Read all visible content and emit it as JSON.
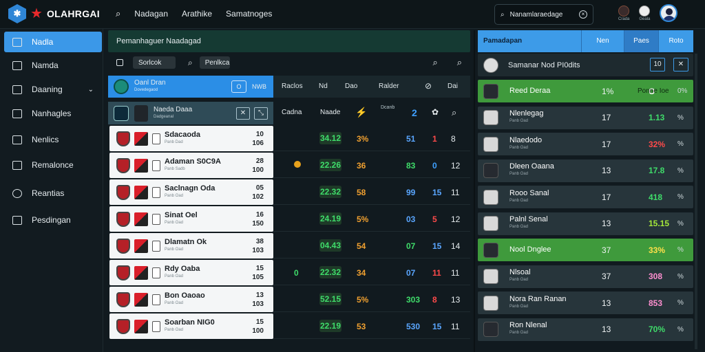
{
  "app": {
    "name": "OLAHRGAI",
    "star_icon": "star-icon",
    "logo_icon": "hex-logo-icon"
  },
  "topnav": [
    "Nadagan",
    "Arathike",
    "Samatnoges"
  ],
  "search": {
    "value": "Nanamlaraedage"
  },
  "top_icons": [
    {
      "label": "Crada"
    },
    {
      "label": "Geala"
    }
  ],
  "sidebar": {
    "items": [
      {
        "label": "Nadla",
        "active": true
      },
      {
        "label": "Namda"
      },
      {
        "label": "Daaning",
        "expandable": true
      },
      {
        "label": "Nanhagles"
      },
      {
        "label": "Nenlics"
      },
      {
        "label": "Remalonce"
      },
      {
        "label": "Reantias"
      },
      {
        "label": "Pesdingan"
      }
    ]
  },
  "main": {
    "title": "Pemanhaguer Naadagad",
    "filter": {
      "select": "Sorlcok",
      "tag": "Penlkca"
    },
    "header": {
      "team": "Oanl Dran",
      "sub": "Dovedegaod",
      "btn": "O",
      "btn2": "NWB",
      "cols": [
        "Raclos",
        "Nd",
        "Dao",
        "Ralder"
      ],
      "col_icons": [
        "⊘",
        "Dai"
      ]
    },
    "selected": {
      "name": "Naeda Daaa",
      "sub": "Dadgeanal",
      "col1": "Cadna",
      "col2": "Naade",
      "col3": "Dcanb"
    },
    "rows": [
      {
        "name": "Sdacaoda",
        "sub": "Panb Dad",
        "n1": "10",
        "n2": "106",
        "coin": false,
        "score": "34.12",
        "pct": "3%",
        "v1": "51",
        "v2": "1",
        "v3": "8",
        "v1c": "#5aa6ff",
        "v2c": "#ff4a4a"
      },
      {
        "name": "Adaman S0C9A",
        "sub": "Panb Sadb",
        "n1": "28",
        "n2": "100",
        "coin": true,
        "score": "22.26",
        "pct": "36",
        "v1": "83",
        "v2": "0",
        "v3": "12",
        "v1c": "#3fdc6a",
        "v2c": "#3fa0ff"
      },
      {
        "name": "Saclnagn Oda",
        "sub": "Panb Oad",
        "n1": "05",
        "n2": "102",
        "coin": false,
        "score": "22.32",
        "pct": "58",
        "v1": "99",
        "v2": "15",
        "v3": "11",
        "v1c": "#5aa6ff",
        "v2c": "#5aa6ff"
      },
      {
        "name": "Sinat Oel",
        "sub": "Panb Oad",
        "n1": "16",
        "n2": "150",
        "coin": false,
        "score": "24.19",
        "pct": "5%",
        "v1": "03",
        "v2": "5",
        "v3": "12",
        "v1c": "#5aa6ff",
        "v2c": "#ff4a4a"
      },
      {
        "name": "Dlamatn Ok",
        "sub": "Panb Oad",
        "n1": "38",
        "n2": "103",
        "coin": false,
        "score": "04.43",
        "pct": "54",
        "v1": "07",
        "v2": "15",
        "v3": "14",
        "v1c": "#3fdc6a",
        "v2c": "#5aa6ff"
      },
      {
        "name": "Rdy Oaba",
        "sub": "Panb Oad",
        "n1": "15",
        "n2": "105",
        "coin": false,
        "score": "22.32",
        "pct": "34",
        "v1": "07",
        "v2": "11",
        "v3": "11",
        "v1c": "#5aa6ff",
        "v2c": "#ff4a4a",
        "zero": "0"
      },
      {
        "name": "Bon Oaoao",
        "sub": "Panb Oad",
        "n1": "13",
        "n2": "103",
        "coin": false,
        "score": "52.15",
        "pct": "5%",
        "v1": "303",
        "v2": "8",
        "v3": "13",
        "v1c": "#3fdc6a",
        "v2c": "#ff4a4a"
      },
      {
        "name": "Soarban NIG0",
        "sub": "Panb Oad",
        "n1": "15",
        "n2": "100",
        "coin": false,
        "score": "22.19",
        "pct": "53",
        "v1": "530",
        "v2": "15",
        "v3": "11",
        "v1c": "#5aa6ff",
        "v2c": "#5aa6ff"
      }
    ]
  },
  "right": {
    "header": [
      "Pamadapan",
      "Nen",
      "Paes",
      "Roto"
    ],
    "sub": {
      "name": "Samanar Nod PI0dits",
      "b1": "10",
      "b2": "O"
    },
    "rows": [
      {
        "name": "Reed Deraa",
        "sub": "",
        "n1": "1%",
        "n2": "O",
        "n3": "Ponne Ioe",
        "n4": "0%",
        "green": true
      },
      {
        "name": "Nlenlegag",
        "sub": "Panb Oad",
        "n1": "17",
        "n2": "1.13",
        "n2c": "#3fdc6a",
        "n3": "%"
      },
      {
        "name": "Nlaedodo",
        "sub": "Panb Oad",
        "n1": "17",
        "n2": "32%",
        "n2c": "#ff4a4a",
        "n3": "%"
      },
      {
        "name": "Dleen Oaana",
        "sub": "Panb Oad",
        "n1": "13",
        "n2": "17.8",
        "n2c": "#3fdc6a",
        "n3": "%"
      },
      {
        "name": "Rooo Sanal",
        "sub": "Panb Oad",
        "n1": "17",
        "n2": "418",
        "n2c": "#3fdc6a",
        "n3": "%"
      },
      {
        "name": "Palnl Senal",
        "sub": "Panb Oad",
        "n1": "13",
        "n2": "15.15",
        "n2c": "#a5e83a",
        "n3": "%"
      },
      {
        "name": "Nool Dnglee",
        "sub": "",
        "n1": "37",
        "n2": "33%",
        "n2c": "#ffe04a",
        "n3": "%",
        "green": true
      },
      {
        "name": "Nlsoal",
        "sub": "Panb Oad",
        "n1": "37",
        "n2": "308",
        "n2c": "#ff8fd0",
        "n3": "%"
      },
      {
        "name": "Nora Ran Ranan",
        "sub": "Panb Oad",
        "n1": "13",
        "n2": "853",
        "n2c": "#ff8fd0",
        "n3": "%"
      },
      {
        "name": "Ron Nlenal",
        "sub": "Panb Oad",
        "n1": "13",
        "n2": "70%",
        "n2c": "#3fdc6a",
        "n3": "%"
      }
    ]
  }
}
